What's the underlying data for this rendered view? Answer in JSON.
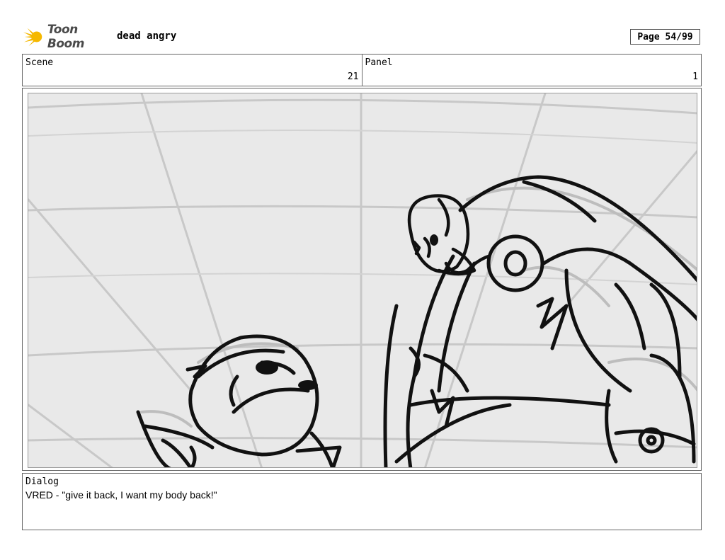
{
  "header": {
    "brand": "Toon Boom",
    "project_title": "dead angry",
    "page": "Page 54/99"
  },
  "info": {
    "scene_label": "Scene",
    "scene_value": "21",
    "panel_label": "Panel",
    "panel_value": "1"
  },
  "dialog": {
    "label": "Dialog",
    "text": "VRED - \"give it back, I want my body back!\""
  },
  "colors": {
    "brand_star": "#f5b800",
    "panel_background": "#e9e9e9",
    "sketch_line": "#111111",
    "grid_line": "#c8c8c8"
  }
}
